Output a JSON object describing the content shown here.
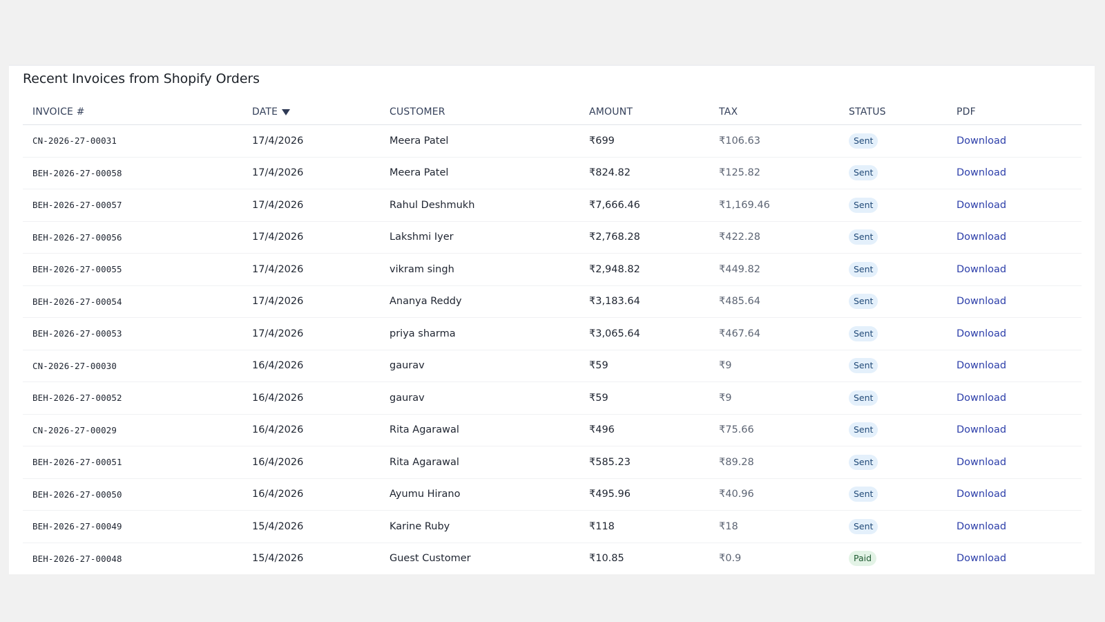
{
  "card": {
    "title": "Recent Invoices from Shopify Orders"
  },
  "table": {
    "columns": [
      "INVOICE #",
      "DATE",
      "CUSTOMER",
      "AMOUNT",
      "TAX",
      "STATUS",
      "PDF"
    ],
    "sort": {
      "column": "DATE",
      "direction": "descending",
      "icon": "sort-down-icon"
    },
    "rows": [
      {
        "invoice": "CN-2026-27-00031",
        "date": "17/4/2026",
        "customer": "Meera Patel",
        "amount": "₹699",
        "tax": "₹106.63",
        "status": "Sent",
        "pdf": "Download"
      },
      {
        "invoice": "BEH-2026-27-00058",
        "date": "17/4/2026",
        "customer": "Meera Patel",
        "amount": "₹824.82",
        "tax": "₹125.82",
        "status": "Sent",
        "pdf": "Download"
      },
      {
        "invoice": "BEH-2026-27-00057",
        "date": "17/4/2026",
        "customer": "Rahul Deshmukh",
        "amount": "₹7,666.46",
        "tax": "₹1,169.46",
        "status": "Sent",
        "pdf": "Download"
      },
      {
        "invoice": "BEH-2026-27-00056",
        "date": "17/4/2026",
        "customer": "Lakshmi Iyer",
        "amount": "₹2,768.28",
        "tax": "₹422.28",
        "status": "Sent",
        "pdf": "Download"
      },
      {
        "invoice": "BEH-2026-27-00055",
        "date": "17/4/2026",
        "customer": "vikram singh",
        "amount": "₹2,948.82",
        "tax": "₹449.82",
        "status": "Sent",
        "pdf": "Download"
      },
      {
        "invoice": "BEH-2026-27-00054",
        "date": "17/4/2026",
        "customer": "Ananya Reddy",
        "amount": "₹3,183.64",
        "tax": "₹485.64",
        "status": "Sent",
        "pdf": "Download"
      },
      {
        "invoice": "BEH-2026-27-00053",
        "date": "17/4/2026",
        "customer": "priya sharma",
        "amount": "₹3,065.64",
        "tax": "₹467.64",
        "status": "Sent",
        "pdf": "Download"
      },
      {
        "invoice": "CN-2026-27-00030",
        "date": "16/4/2026",
        "customer": "gaurav",
        "amount": "₹59",
        "tax": "₹9",
        "status": "Sent",
        "pdf": "Download"
      },
      {
        "invoice": "BEH-2026-27-00052",
        "date": "16/4/2026",
        "customer": "gaurav",
        "amount": "₹59",
        "tax": "₹9",
        "status": "Sent",
        "pdf": "Download"
      },
      {
        "invoice": "CN-2026-27-00029",
        "date": "16/4/2026",
        "customer": "Rita Agarawal",
        "amount": "₹496",
        "tax": "₹75.66",
        "status": "Sent",
        "pdf": "Download"
      },
      {
        "invoice": "BEH-2026-27-00051",
        "date": "16/4/2026",
        "customer": "Rita Agarawal",
        "amount": "₹585.23",
        "tax": "₹89.28",
        "status": "Sent",
        "pdf": "Download"
      },
      {
        "invoice": "BEH-2026-27-00050",
        "date": "16/4/2026",
        "customer": "Ayumu Hirano",
        "amount": "₹495.96",
        "tax": "₹40.96",
        "status": "Sent",
        "pdf": "Download"
      },
      {
        "invoice": "BEH-2026-27-00049",
        "date": "15/4/2026",
        "customer": "Karine Ruby",
        "amount": "₹118",
        "tax": "₹18",
        "status": "Sent",
        "pdf": "Download"
      },
      {
        "invoice": "BEH-2026-27-00048",
        "date": "15/4/2026",
        "customer": "Guest Customer",
        "amount": "₹10.85",
        "tax": "₹0.9",
        "status": "Paid",
        "pdf": "Download"
      }
    ]
  },
  "colors": {
    "page_bg": "#f1f1f1",
    "card_bg": "#ffffff",
    "header_text": "#34405a",
    "link": "#2c3ea9",
    "badge_sent_bg": "#e4f0fb",
    "badge_sent_text": "#214a78",
    "badge_paid_bg": "#e3f3e6",
    "badge_paid_text": "#1f5a31"
  }
}
